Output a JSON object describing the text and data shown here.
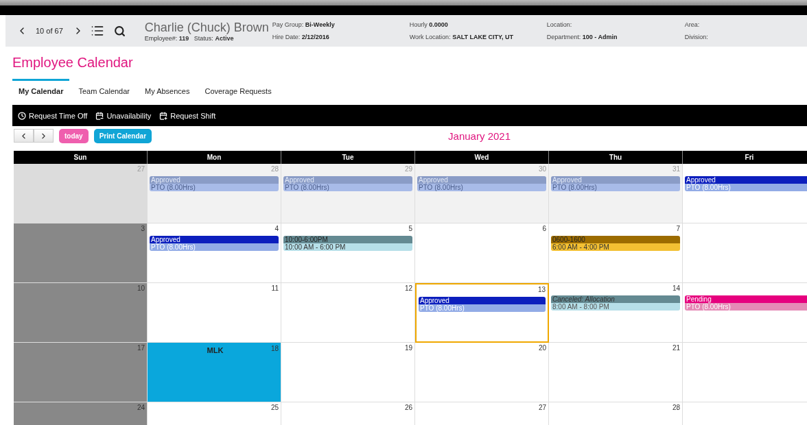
{
  "header": {
    "pager": "10 of 67",
    "name": "Charlie (Chuck) Brown",
    "employee_label": "Employee#:",
    "employee_value": "119",
    "status_label": "Status:",
    "status_value": "Active",
    "fields": [
      {
        "label": "Pay Group:",
        "value": "Bi-Weekly"
      },
      {
        "label": "Hire Date:",
        "value": "2/12/2016"
      },
      {
        "label": "Hourly",
        "value": "0.0000"
      },
      {
        "label": "Work Location:",
        "value": "SALT LAKE CITY, UT"
      },
      {
        "label": "Location:"
      },
      {
        "label": "Department:",
        "value": "100 - Admin"
      },
      {
        "label": "Area:"
      },
      {
        "label": "Division:"
      }
    ]
  },
  "title": "Employee Calendar",
  "tabs": [
    {
      "label": "My Calendar",
      "selected": true
    },
    {
      "label": "Team Calendar",
      "selected": false
    },
    {
      "label": "My Absences",
      "selected": false
    },
    {
      "label": "Coverage Requests",
      "selected": false
    }
  ],
  "toolbar": [
    {
      "kind": "clock",
      "label": "Request Time Off"
    },
    {
      "kind": "minus",
      "label": "Unavailability"
    },
    {
      "kind": "plus",
      "label": "Request Shift"
    }
  ],
  "nav": {
    "today": "today",
    "print": "Print Calendar",
    "month": "January 2021"
  },
  "weekdays": [
    "Sun",
    "Mon",
    "Tue",
    "Wed",
    "Thu",
    "Fri"
  ],
  "weeks": [
    {
      "days": [
        {
          "kind": "other-sun",
          "date": "27",
          "today": false
        },
        {
          "kind": "other",
          "date": "28",
          "today": false,
          "events": [
            {
              "kind": "pto-approved",
              "title": "Approved",
              "detail": "PTO (8.00Hrs)"
            }
          ]
        },
        {
          "kind": "other",
          "date": "29",
          "today": false,
          "events": [
            {
              "kind": "pto-approved",
              "title": "Approved",
              "detail": "PTO (8.00Hrs)"
            }
          ]
        },
        {
          "kind": "other",
          "date": "30",
          "today": false,
          "events": [
            {
              "kind": "pto-approved",
              "title": "Approved",
              "detail": "PTO (8.00Hrs)"
            }
          ]
        },
        {
          "kind": "other",
          "date": "31",
          "today": false,
          "events": [
            {
              "kind": "pto-approved",
              "title": "Approved",
              "detail": "PTO (8.00Hrs)"
            }
          ]
        },
        {
          "kind": "normal",
          "today": false,
          "events": [
            {
              "kind": "pto-approved",
              "title": "Approved",
              "detail": "PTO (8.00Hrs)"
            }
          ]
        }
      ]
    },
    {
      "days": [
        {
          "kind": "sun",
          "date": "3",
          "today": false
        },
        {
          "kind": "normal",
          "date": "4",
          "today": false,
          "events": [
            {
              "kind": "pto-approved",
              "title": "Approved",
              "detail": "PTO (8.00Hrs)"
            }
          ]
        },
        {
          "kind": "normal",
          "date": "5",
          "today": false,
          "events": [
            {
              "kind": "shift-teal",
              "title": "10:00-6:00PM",
              "detail": "10:00 AM - 6:00 PM"
            }
          ]
        },
        {
          "kind": "normal",
          "date": "6",
          "today": false
        },
        {
          "kind": "normal",
          "date": "7",
          "today": false,
          "events": [
            {
              "kind": "shift-gold",
              "title": "0600-1600",
              "detail": "6:00 AM - 4:00 PM"
            }
          ]
        },
        {
          "kind": "normal",
          "today": false
        }
      ]
    },
    {
      "days": [
        {
          "kind": "sun",
          "date": "10",
          "today": false
        },
        {
          "kind": "normal",
          "date": "11",
          "today": false
        },
        {
          "kind": "normal",
          "date": "12",
          "today": false
        },
        {
          "kind": "normal",
          "date": "13",
          "today": true,
          "events": [
            {
              "kind": "pto-approved",
              "title": "Approved",
              "detail": "PTO (8.00Hrs)"
            }
          ]
        },
        {
          "kind": "normal",
          "date": "14",
          "today": false,
          "events": [
            {
              "kind": "canceled",
              "title": "Canceled: Allocation",
              "detail": "8:00 AM - 8:00 PM"
            }
          ]
        },
        {
          "kind": "normal",
          "today": false,
          "events": [
            {
              "kind": "pto-pending",
              "title": "Pending",
              "detail": "PTO (8.00Hrs)"
            }
          ]
        }
      ]
    },
    {
      "days": [
        {
          "kind": "sun",
          "date": "17",
          "today": false
        },
        {
          "kind": "holiday",
          "date": "18",
          "holiday": "MLK",
          "today": false
        },
        {
          "kind": "normal",
          "date": "19",
          "today": false
        },
        {
          "kind": "normal",
          "date": "20",
          "today": false
        },
        {
          "kind": "normal",
          "date": "21",
          "today": false
        },
        {
          "kind": "normal",
          "today": false
        }
      ]
    },
    {
      "days": [
        {
          "kind": "sun",
          "date": "24",
          "today": false
        },
        {
          "kind": "normal",
          "date": "25",
          "today": false
        },
        {
          "kind": "normal",
          "date": "26",
          "today": false
        },
        {
          "kind": "normal",
          "date": "27",
          "today": false
        },
        {
          "kind": "normal",
          "date": "28",
          "today": false
        },
        {
          "kind": "normal",
          "today": false
        }
      ]
    }
  ]
}
